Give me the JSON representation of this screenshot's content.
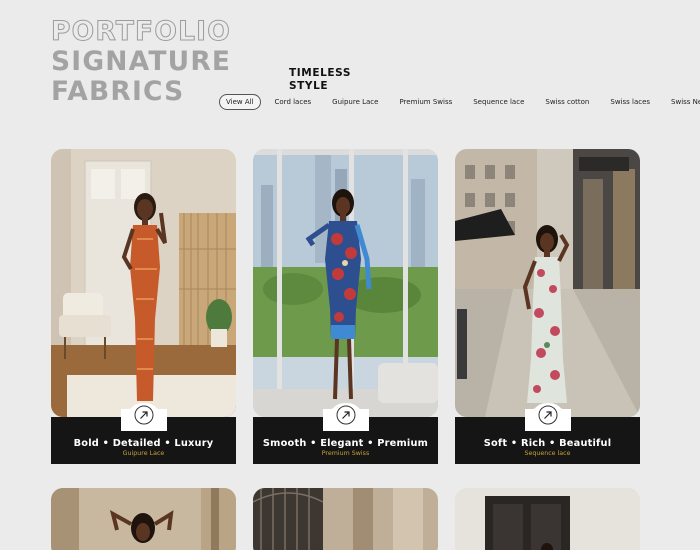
{
  "header": {
    "title_line1": "PORTFOLIO",
    "title_line2": "SIGNATURE",
    "title_line3": "FABRICS",
    "tagline_line1": "TIMELESS",
    "tagline_line2": "STYLE"
  },
  "filters": [
    {
      "label": "View All",
      "active": true
    },
    {
      "label": "Cord laces",
      "active": false
    },
    {
      "label": "Guipure Lace",
      "active": false
    },
    {
      "label": "Premium Swiss",
      "active": false
    },
    {
      "label": "Sequence lace",
      "active": false
    },
    {
      "label": "Swiss cotton",
      "active": false
    },
    {
      "label": "Swiss laces",
      "active": false
    },
    {
      "label": "Swiss Net",
      "active": false
    }
  ],
  "cards": [
    {
      "title": "Bold • Detailed • Luxury",
      "fabric": "Guipure Lace",
      "icon": "arrow-up-right-icon"
    },
    {
      "title": "Smooth • Elegant • Premium",
      "fabric": "Premium Swiss",
      "icon": "arrow-up-right-icon"
    },
    {
      "title": "Soft • Rich • Beautiful",
      "fabric": "Sequence lace",
      "icon": "arrow-up-right-icon"
    }
  ],
  "colors": {
    "background": "#ebebeb",
    "caption_bar": "#151515",
    "fabric_label": "#c9a13b"
  }
}
